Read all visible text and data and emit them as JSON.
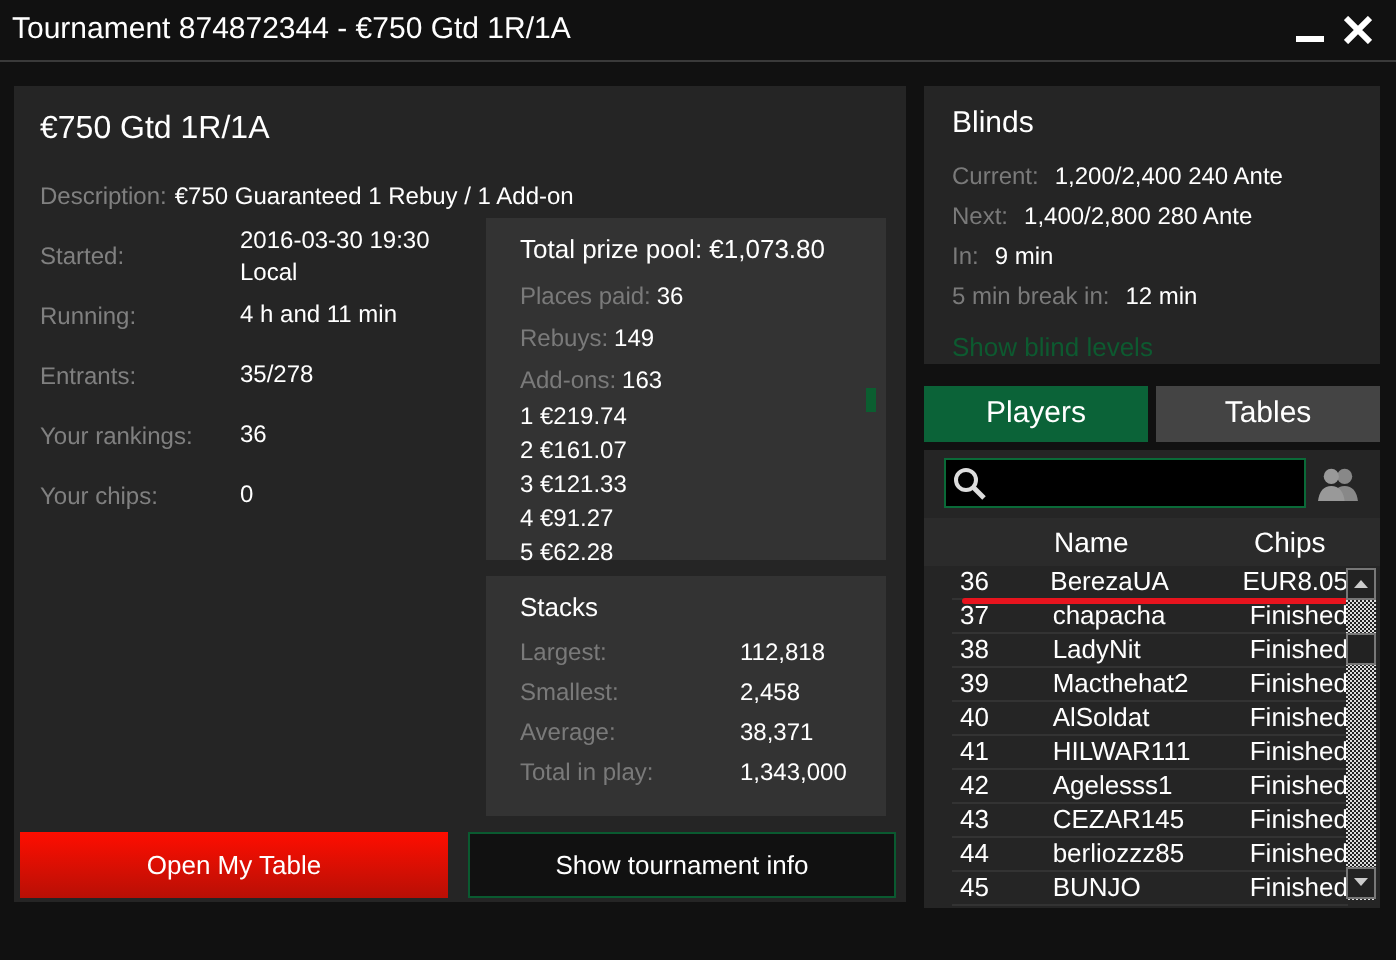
{
  "window": {
    "title": "Tournament 874872344 - €750 Gtd 1R/1A"
  },
  "info": {
    "title": "€750 Gtd 1R/1A",
    "description_label": "Description:",
    "description": "€750 Guaranteed 1 Rebuy / 1 Add-on",
    "rows": [
      {
        "label": "Started:",
        "value": "2016-03-30 19:30",
        "value_2": "Local"
      },
      {
        "label": "Running:",
        "value": "4 h and 11 min"
      },
      {
        "label": "Entrants:",
        "value": "35/278"
      },
      {
        "label": "Your rankings:",
        "value": "36"
      },
      {
        "label": "Your chips:",
        "value": "0"
      }
    ]
  },
  "prizes": {
    "title": "Total prize pool: €1,073.80",
    "stats": [
      {
        "label": "Places paid:",
        "value": "36"
      },
      {
        "label": "Rebuys:",
        "value": "149"
      },
      {
        "label": "Add-ons:",
        "value": "163"
      }
    ],
    "places": [
      "1 €219.74",
      "2 €161.07",
      "3 €121.33",
      "4 €91.27",
      "5 €62.28"
    ]
  },
  "stacks": {
    "title": "Stacks",
    "rows": [
      {
        "label": "Largest:",
        "value": "112,818"
      },
      {
        "label": "Smallest:",
        "value": "2,458"
      },
      {
        "label": "Average:",
        "value": "38,371"
      },
      {
        "label": "Total in play:",
        "value": "1,343,000"
      }
    ]
  },
  "buttons": [
    {
      "label": "Open My Table",
      "kind": "primary"
    },
    {
      "label": "Show tournament info",
      "kind": "secondary"
    }
  ],
  "blinds": {
    "title": "Blinds",
    "rows": [
      {
        "label": "Current:",
        "value": "1,200/2,400 240 Ante"
      },
      {
        "label": "Next:",
        "value": "1,400/2,800 280 Ante"
      },
      {
        "label": "In:",
        "value": "9 min"
      },
      {
        "label": "5 min break in:",
        "value": "12 min"
      }
    ],
    "link": "Show blind levels"
  },
  "tabs": [
    {
      "label": "Players",
      "selected": true
    },
    {
      "label": "Tables",
      "selected": false
    }
  ],
  "players": {
    "columns": [
      "Name",
      "Chips"
    ],
    "rows": [
      {
        "rank": "36",
        "name": "BerezaUA",
        "chips": "EUR8.05",
        "selected": true
      },
      {
        "rank": "37",
        "name": "chapacha",
        "chips": "Finished",
        "selected": false
      },
      {
        "rank": "38",
        "name": "LadyNit",
        "chips": "Finished",
        "selected": false
      },
      {
        "rank": "39",
        "name": "Macthehat2",
        "chips": "Finished",
        "selected": false
      },
      {
        "rank": "40",
        "name": "AlSoldat",
        "chips": "Finished",
        "selected": false
      },
      {
        "rank": "41",
        "name": "HILWAR111",
        "chips": "Finished",
        "selected": false
      },
      {
        "rank": "42",
        "name": "Agelesss1",
        "chips": "Finished",
        "selected": false
      },
      {
        "rank": "43",
        "name": "CEZAR145",
        "chips": "Finished",
        "selected": false
      },
      {
        "rank": "44",
        "name": "berliozzz85",
        "chips": "Finished",
        "selected": false
      },
      {
        "rank": "45",
        "name": "BUNJO",
        "chips": "Finished",
        "selected": false
      }
    ]
  }
}
